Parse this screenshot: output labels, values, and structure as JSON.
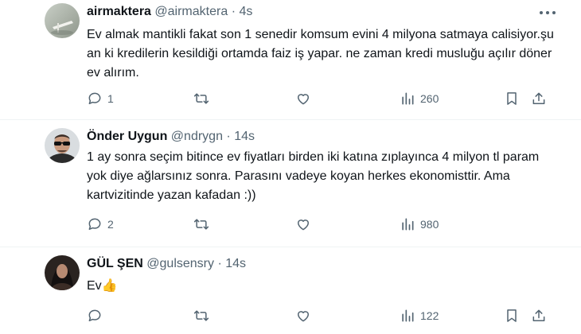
{
  "tweets": [
    {
      "name": "airmaktera",
      "handle": "@airmaktera",
      "sep": "·",
      "time": "4s",
      "text": "Ev almak mantikli fakat son 1 senedir komsum evini 4 milyona satmaya calisiyor.şu an ki kredilerin kesildiği ortamda faiz iş yapar. ne zaman kredi musluğu açılır döner ev alırım.",
      "replies": "1",
      "retweets": "",
      "likes": "",
      "views": "260"
    },
    {
      "name": "Önder Uygun",
      "handle": "@ndrygn",
      "sep": "·",
      "time": "14s",
      "text": "1 ay sonra seçim bitince ev fiyatları birden iki katına zıplayınca 4 milyon tl param yok diye ağlarsınız sonra. Parasını vadeye koyan herkes ekonomisttir. Ama kartvizitinde yazan kafadan :))",
      "replies": "2",
      "retweets": "",
      "likes": "",
      "views": "980"
    },
    {
      "name": "GÜL ŞEN",
      "handle": "@gulsensry",
      "sep": "·",
      "time": "14s",
      "text": "Ev👍",
      "replies": "",
      "retweets": "",
      "likes": "",
      "views": "122"
    }
  ],
  "icons": {
    "reply": "reply-icon",
    "retweet": "retweet-icon",
    "like": "heart-icon",
    "views": "views-icon",
    "bookmark": "bookmark-icon",
    "share": "share-icon",
    "more": "more-icon"
  },
  "colors": {
    "text": "#0f1419",
    "secondary": "#536471",
    "divider": "#eff3f4"
  }
}
